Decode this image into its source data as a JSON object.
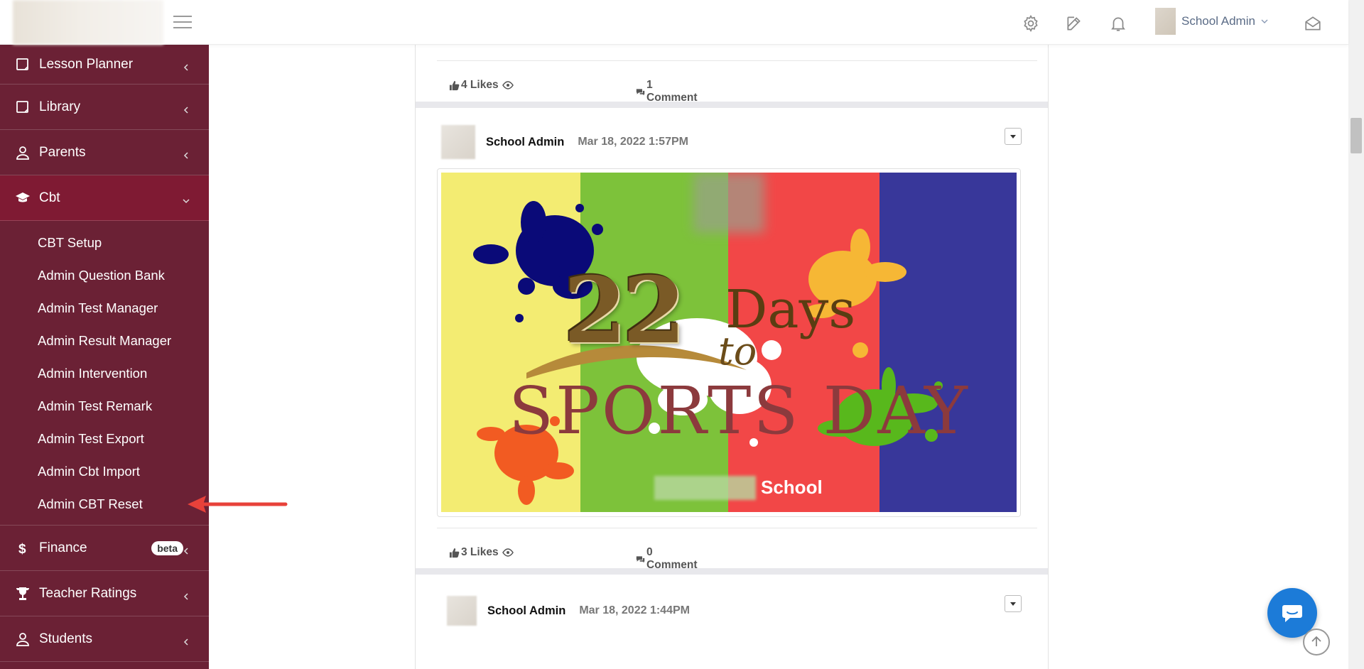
{
  "header": {
    "user_name": "School Admin",
    "icons": [
      "settings-icon",
      "edit-icon",
      "bell-icon",
      "mail-icon"
    ]
  },
  "sidebar": {
    "items_top": [
      {
        "label": "Lesson Planner",
        "icon": "note-icon"
      },
      {
        "label": "Library",
        "icon": "note-icon"
      },
      {
        "label": "Parents",
        "icon": "user-icon"
      }
    ],
    "active": {
      "label": "Cbt",
      "icon": "graduation-cap-icon"
    },
    "submenu": [
      "CBT Setup",
      "Admin Question Bank",
      "Admin Test Manager",
      "Admin Result Manager",
      "Admin Intervention",
      "Admin Test Remark",
      "Admin Test Export",
      "Admin Cbt Import",
      "Admin CBT Reset"
    ],
    "items_bottom": [
      {
        "label": "Finance",
        "icon": "dollar-icon",
        "badge": "beta"
      },
      {
        "label": "Teacher Ratings",
        "icon": "trophy-icon"
      },
      {
        "label": "Students",
        "icon": "user-icon"
      }
    ],
    "colors": {
      "background": "#6b2135",
      "active": "#7f1a33"
    }
  },
  "feed": {
    "post_prev": {
      "likes": "4 Likes",
      "comments": "1 Comment"
    },
    "post_main": {
      "author": "School Admin",
      "time": "Mar 18, 2022 1:57PM",
      "image": {
        "number": "22",
        "days": "Days",
        "to": "to",
        "headline": "SPORTS DAY",
        "school": "School",
        "stripe_colors": [
          "#f3ec72",
          "#7dc23a",
          "#f24747",
          "#38379a"
        ]
      },
      "likes": "3 Likes",
      "comments": "0 Comment"
    },
    "post_next": {
      "author": "School Admin",
      "time": "Mar 18, 2022 1:44PM"
    }
  },
  "accent_colors": {
    "chat_button": "#1c7bd8",
    "annotation_arrow": "#e8413a"
  }
}
